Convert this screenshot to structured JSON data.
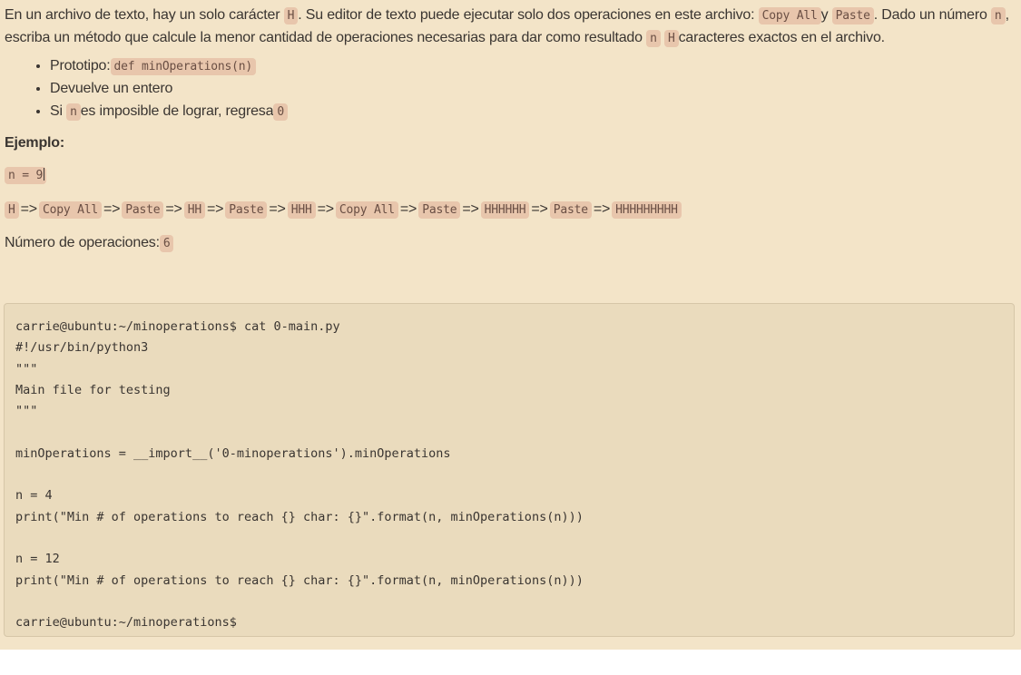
{
  "intro": {
    "t1": "En un archivo de texto, hay un solo carácter ",
    "c1": "H",
    "t2": ". Su editor de texto puede ejecutar solo dos operaciones en este archivo: ",
    "c2": "Copy All",
    "t3": "y ",
    "c3": "Paste",
    "t4": ". Dado un número ",
    "c4": "n",
    "t5": ", escriba un método que calcule la menor cantidad de operaciones necesarias para dar como resultado ",
    "c5": "n",
    "c6": "H",
    "t6": "caracteres exactos en el archivo."
  },
  "bullets": {
    "b1_text": "Prototipo:",
    "b1_code": "def minOperations(n)",
    "b2_text": "Devuelve un entero",
    "b3_text1": "Si ",
    "b3_code1": "n",
    "b3_text2": "es imposible de lograr, regresa",
    "b3_code2": "0"
  },
  "example": {
    "heading": "Ejemplo:",
    "n_code": "n = 9",
    "arrow": "=>",
    "sequence": [
      "H",
      "Copy All",
      "Paste",
      "HH",
      "Paste",
      "HHH",
      "Copy All",
      "Paste",
      "HHHHHH",
      "Paste",
      "HHHHHHHHH"
    ],
    "ops_label": "Número de operaciones:",
    "ops_value": "6"
  },
  "code_block": {
    "lines": [
      "carrie@ubuntu:~/minoperations$ cat 0-main.py",
      "#!/usr/bin/python3",
      "\"\"\"",
      "Main file for testing",
      "\"\"\"",
      "",
      "minOperations = __import__('0-minoperations').minOperations",
      "",
      "n = 4",
      "print(\"Min # of operations to reach {} char: {}\".format(n, minOperations(n)))",
      "",
      "n = 12",
      "print(\"Min # of operations to reach {} char: {}\".format(n, minOperations(n)))",
      "",
      "carrie@ubuntu:~/minoperations$"
    ]
  }
}
